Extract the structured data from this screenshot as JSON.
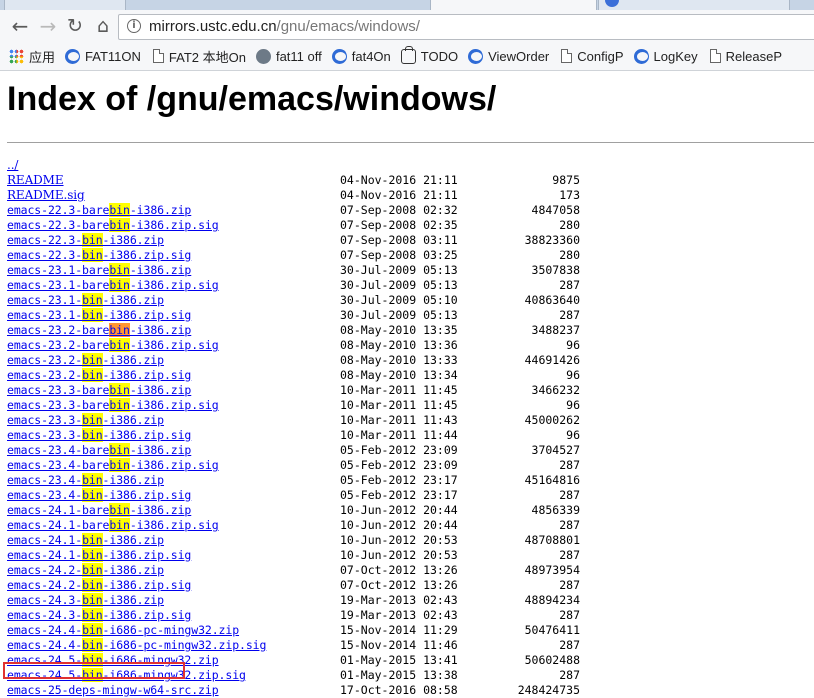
{
  "browser": {
    "url_host": "mirrors.ustc.edu.cn",
    "url_path": "/gnu/emacs/windows/",
    "bookmarks": [
      {
        "label": "应用",
        "icon": "apps-icon"
      },
      {
        "label": "FAT11ON",
        "icon": "fat-icon"
      },
      {
        "label": "FAT2 本地On",
        "icon": "page-icon"
      },
      {
        "label": "fat11 off",
        "icon": "bird-icon"
      },
      {
        "label": "fat4On",
        "icon": "fat-icon"
      },
      {
        "label": "TODO",
        "icon": "todo-icon"
      },
      {
        "label": "ViewOrder",
        "icon": "fat-icon"
      },
      {
        "label": "ConfigP",
        "icon": "page-icon"
      },
      {
        "label": "LogKey",
        "icon": "fat-icon"
      },
      {
        "label": "ReleaseP",
        "icon": "page-icon"
      }
    ]
  },
  "page": {
    "title": "Index of /gnu/emacs/windows/",
    "parent_link": "../",
    "highlight_term": "bin",
    "entries": [
      {
        "name": "README",
        "date": "04-Nov-2016 21:11",
        "size": "9875"
      },
      {
        "name": "README.sig",
        "date": "04-Nov-2016 21:11",
        "size": "173"
      },
      {
        "name": "emacs-22.3-barebin-i386.zip",
        "date": "07-Sep-2008 02:32",
        "size": "4847058"
      },
      {
        "name": "emacs-22.3-barebin-i386.zip.sig",
        "date": "07-Sep-2008 02:35",
        "size": "280"
      },
      {
        "name": "emacs-22.3-bin-i386.zip",
        "date": "07-Sep-2008 03:11",
        "size": "38823360"
      },
      {
        "name": "emacs-22.3-bin-i386.zip.sig",
        "date": "07-Sep-2008 03:25",
        "size": "280"
      },
      {
        "name": "emacs-23.1-barebin-i386.zip",
        "date": "30-Jul-2009 05:13",
        "size": "3507838"
      },
      {
        "name": "emacs-23.1-barebin-i386.zip.sig",
        "date": "30-Jul-2009 05:13",
        "size": "287"
      },
      {
        "name": "emacs-23.1-bin-i386.zip",
        "date": "30-Jul-2009 05:10",
        "size": "40863640"
      },
      {
        "name": "emacs-23.1-bin-i386.zip.sig",
        "date": "30-Jul-2009 05:13",
        "size": "287"
      },
      {
        "name": "emacs-23.2-barebin-i386.zip",
        "date": "08-May-2010 13:35",
        "size": "3488237",
        "current_match": true
      },
      {
        "name": "emacs-23.2-barebin-i386.zip.sig",
        "date": "08-May-2010 13:36",
        "size": "96"
      },
      {
        "name": "emacs-23.2-bin-i386.zip",
        "date": "08-May-2010 13:33",
        "size": "44691426"
      },
      {
        "name": "emacs-23.2-bin-i386.zip.sig",
        "date": "08-May-2010 13:34",
        "size": "96"
      },
      {
        "name": "emacs-23.3-barebin-i386.zip",
        "date": "10-Mar-2011 11:45",
        "size": "3466232"
      },
      {
        "name": "emacs-23.3-barebin-i386.zip.sig",
        "date": "10-Mar-2011 11:45",
        "size": "96"
      },
      {
        "name": "emacs-23.3-bin-i386.zip",
        "date": "10-Mar-2011 11:43",
        "size": "45000262"
      },
      {
        "name": "emacs-23.3-bin-i386.zip.sig",
        "date": "10-Mar-2011 11:44",
        "size": "96"
      },
      {
        "name": "emacs-23.4-barebin-i386.zip",
        "date": "05-Feb-2012 23:09",
        "size": "3704527"
      },
      {
        "name": "emacs-23.4-barebin-i386.zip.sig",
        "date": "05-Feb-2012 23:09",
        "size": "287"
      },
      {
        "name": "emacs-23.4-bin-i386.zip",
        "date": "05-Feb-2012 23:17",
        "size": "45164816"
      },
      {
        "name": "emacs-23.4-bin-i386.zip.sig",
        "date": "05-Feb-2012 23:17",
        "size": "287"
      },
      {
        "name": "emacs-24.1-barebin-i386.zip",
        "date": "10-Jun-2012 20:44",
        "size": "4856339"
      },
      {
        "name": "emacs-24.1-barebin-i386.zip.sig",
        "date": "10-Jun-2012 20:44",
        "size": "287"
      },
      {
        "name": "emacs-24.1-bin-i386.zip",
        "date": "10-Jun-2012 20:53",
        "size": "48708801"
      },
      {
        "name": "emacs-24.1-bin-i386.zip.sig",
        "date": "10-Jun-2012 20:53",
        "size": "287"
      },
      {
        "name": "emacs-24.2-bin-i386.zip",
        "date": "07-Oct-2012 13:26",
        "size": "48973954"
      },
      {
        "name": "emacs-24.2-bin-i386.zip.sig",
        "date": "07-Oct-2012 13:26",
        "size": "287"
      },
      {
        "name": "emacs-24.3-bin-i386.zip",
        "date": "19-Mar-2013 02:43",
        "size": "48894234",
        "boxed": true
      },
      {
        "name": "emacs-24.3-bin-i386.zip.sig",
        "date": "19-Mar-2013 02:43",
        "size": "287"
      },
      {
        "name": "emacs-24.4-bin-i686-pc-mingw32.zip",
        "date": "15-Nov-2014 11:29",
        "size": "50476411"
      },
      {
        "name": "emacs-24.4-bin-i686-pc-mingw32.zip.sig",
        "date": "15-Nov-2014 11:46",
        "size": "287"
      },
      {
        "name": "emacs-24.5-bin-i686-mingw32.zip",
        "date": "01-May-2015 13:41",
        "size": "50602488"
      },
      {
        "name": "emacs-24.5-bin-i686-mingw32.zip.sig",
        "date": "01-May-2015 13:38",
        "size": "287"
      },
      {
        "name": "emacs-25-deps-mingw-w64-src.zip",
        "date": "17-Oct-2016 08:58",
        "size": "248424735"
      }
    ]
  }
}
